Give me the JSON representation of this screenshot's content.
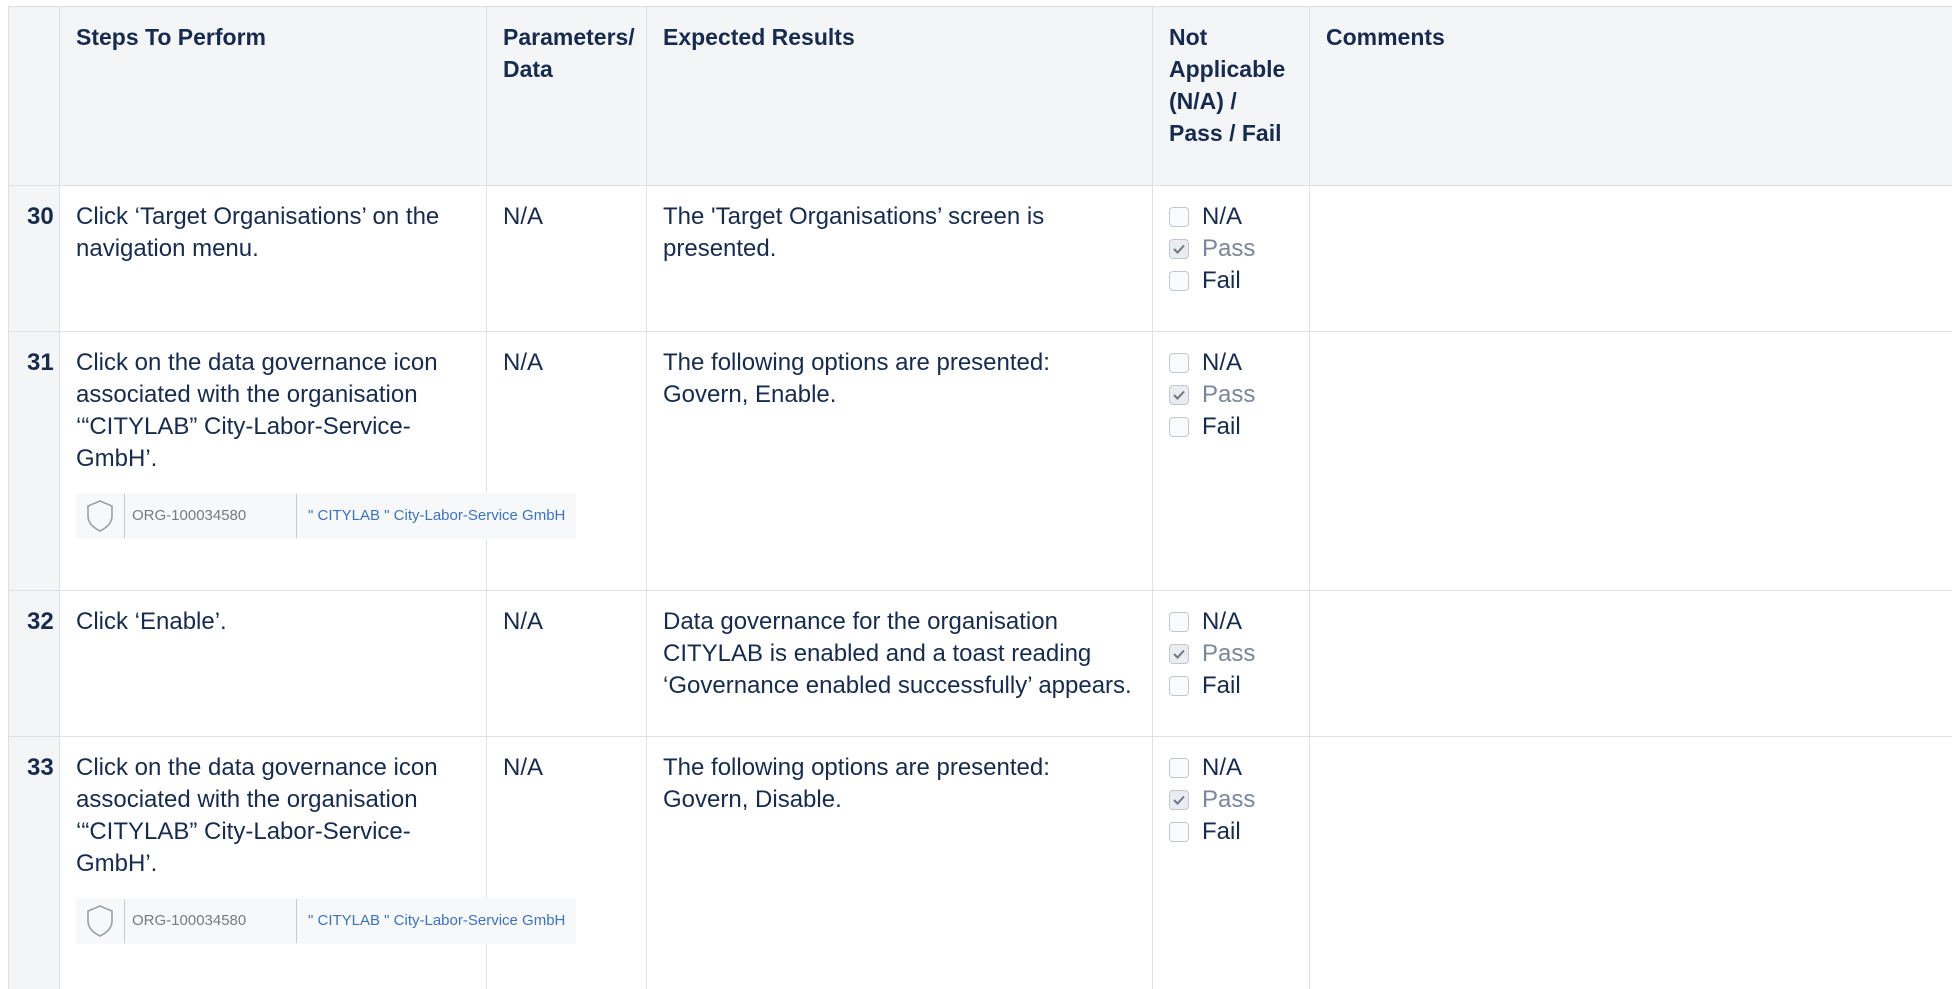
{
  "headers": {
    "num": "",
    "steps": "Steps To Perform",
    "params": "Parameters/ Data",
    "expected": "Expected Results",
    "status": "Not Applicable (N/A) / Pass / Fail",
    "comments": "Comments"
  },
  "status_options": [
    "N/A",
    "Pass",
    "Fail"
  ],
  "rows": [
    {
      "num": "30",
      "step": "Click ‘Target Organisations’ on the navigation menu.",
      "params": "N/A",
      "expected": "The 'Target Organisations’ screen is presented.",
      "checked": "Pass",
      "comments": ""
    },
    {
      "num": "31",
      "step": "Click on the data governance icon associated with the organisation ‘“CITYLAB” City-Labor-Service-GmbH’.",
      "snippet": {
        "icon": "shield-icon",
        "org_id": "ORG-100034580",
        "org_name": "\" CITYLAB \" City-Labor-Service GmbH"
      },
      "params": "N/A",
      "expected": "The following options are presented: Govern, Enable.",
      "checked": "Pass",
      "comments": ""
    },
    {
      "num": "32",
      "step": "Click ‘Enable’.",
      "params": "N/A",
      "expected": "Data governance for the organisation CITYLAB is enabled and a toast reading ‘Governance enabled successfully’ appears.",
      "checked": "Pass",
      "comments": ""
    },
    {
      "num": "33",
      "step": "Click on the data governance icon associated with the organisation ‘“CITYLAB” City-Labor-Service-GmbH’.",
      "snippet": {
        "icon": "shield-icon",
        "org_id": "ORG-100034580",
        "org_name": "\" CITYLAB \" City-Labor-Service GmbH"
      },
      "params": "N/A",
      "expected": "The following options are presented: Govern, Disable.",
      "checked": "Pass",
      "comments": ""
    }
  ],
  "colors": {
    "header_bg": "#f4f5f7",
    "border": "#dfe1e6",
    "text": "#172b4d",
    "muted_text": "#7a869a",
    "link_blue": "#3d73b9"
  }
}
